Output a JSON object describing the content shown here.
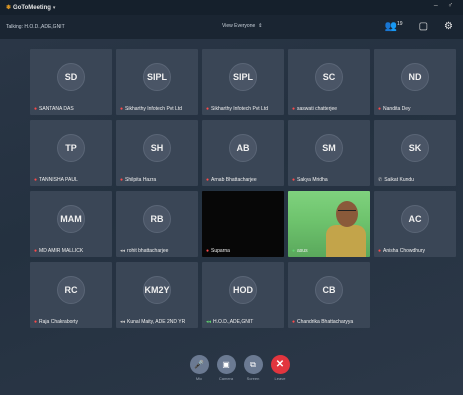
{
  "titlebar": {
    "logo_glyph": "❄",
    "app_name": "GoToMeeting",
    "chevron": "▾",
    "window_controls": "– ♂"
  },
  "infobar": {
    "talking": "Talking: H.O.D.,ADE,GNIT",
    "view": "View Everyone",
    "view_chevron": "⇕",
    "participants_icon": "👥",
    "participants_count": "19",
    "screen_icon": "▢",
    "settings_icon": "⚙"
  },
  "tiles": [
    {
      "initials": "SD",
      "name": "SANTANA DAS",
      "mic": "muted"
    },
    {
      "initials": "SIPL",
      "name": "Sikharthy Infotech Pvt Ltd",
      "mic": "muted"
    },
    {
      "initials": "SIPL",
      "name": "Sikharthy Infotech Pvt Ltd",
      "mic": "muted"
    },
    {
      "initials": "SC",
      "name": "saswati chatterjee",
      "mic": "muted"
    },
    {
      "initials": "ND",
      "name": "Nandita Dey",
      "mic": "muted"
    },
    {
      "initials": "TP",
      "name": "TANNISHA PAUL",
      "mic": "muted"
    },
    {
      "initials": "SH",
      "name": "Shilpita Hazra",
      "mic": "muted"
    },
    {
      "initials": "AB",
      "name": "Arnab Bhattacharjee",
      "mic": "muted"
    },
    {
      "initials": "SM",
      "name": "Sakya Mridha",
      "mic": "muted"
    },
    {
      "initials": "SK",
      "name": "Saikat Kundu",
      "mic": "phone"
    },
    {
      "initials": "MAM",
      "name": "MD AMIR MALLICK",
      "mic": "muted"
    },
    {
      "initials": "RB",
      "name": "rohit bhattacharjee",
      "mic": "neutral"
    },
    {
      "initials": "",
      "name": "Suparna",
      "mic": "muted"
    },
    {
      "initials": "",
      "name": "asus",
      "mic": "on"
    },
    {
      "initials": "AC",
      "name": "Anisha Chowdhury",
      "mic": "muted"
    },
    {
      "initials": "RC",
      "name": "Raja Chakraborty",
      "mic": "muted"
    },
    {
      "initials": "KM2Y",
      "name": "Kunal Maity, ADE 2ND YR",
      "mic": "neutral"
    },
    {
      "initials": "HOD",
      "name": "H.O.D.,ADE,GNIT",
      "mic": "on"
    },
    {
      "initials": "CB",
      "name": "Chandrika Bhattacharyya",
      "mic": "muted"
    }
  ],
  "controls": [
    {
      "icon": "🎤",
      "label": "Mic"
    },
    {
      "icon": "▣",
      "label": "Camera"
    },
    {
      "icon": "⧉",
      "label": "Screen"
    },
    {
      "icon": "✕",
      "label": "Leave"
    }
  ]
}
